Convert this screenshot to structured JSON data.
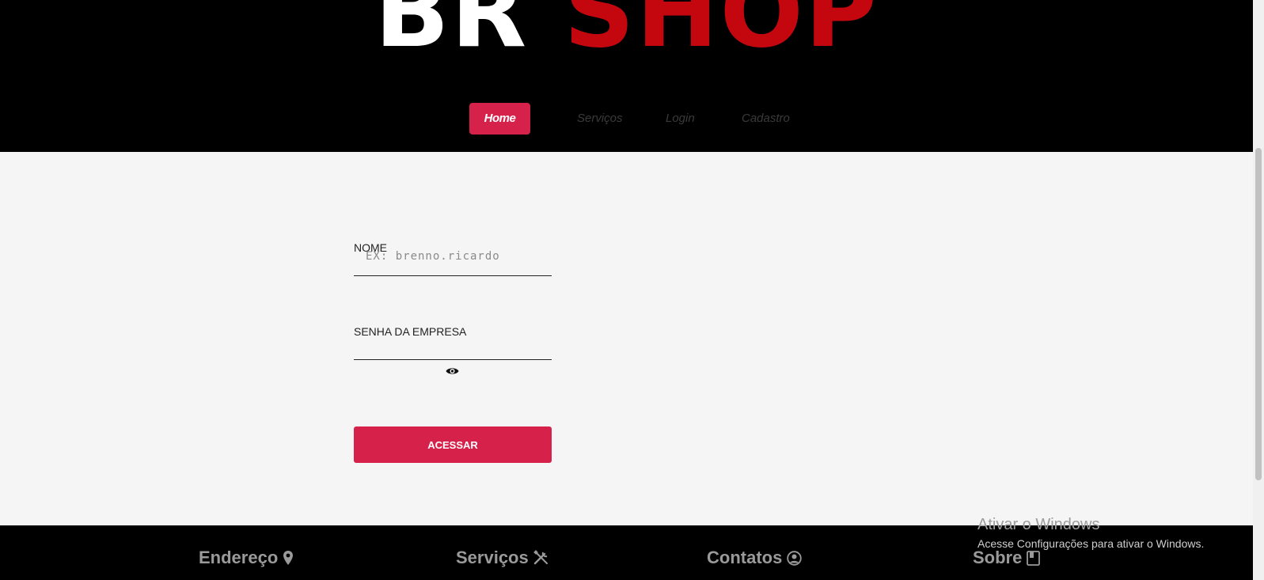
{
  "logo": {
    "part1": "BR",
    "part2": "SHOP"
  },
  "nav": {
    "items": [
      {
        "label": "Home"
      },
      {
        "label": "Serviços"
      },
      {
        "label": "Login"
      },
      {
        "label": "Cadastro"
      }
    ]
  },
  "form": {
    "nome_label": "NOME",
    "nome_placeholder": "EX: brenno.ricardo",
    "senha_label": "SENHA DA EMPRESA",
    "submit_label": "ACESSAR",
    "show_password_icon": "eye-icon"
  },
  "footer": {
    "items": [
      {
        "label": "Endereço",
        "icon": "map-pin-icon"
      },
      {
        "label": "Serviços",
        "icon": "tools-icon"
      },
      {
        "label": "Contatos",
        "icon": "user-circle-icon"
      },
      {
        "label": "Sobre",
        "icon": "book-icon"
      }
    ]
  },
  "os_watermark": {
    "title": "Ativar o Windows",
    "subtitle": "Acesse Configurações para ativar o Windows."
  },
  "colors": {
    "accent": "#d6224a",
    "logo_red": "#c4070f",
    "header_bg": "#000000",
    "body_bg": "#f5f5f5"
  }
}
